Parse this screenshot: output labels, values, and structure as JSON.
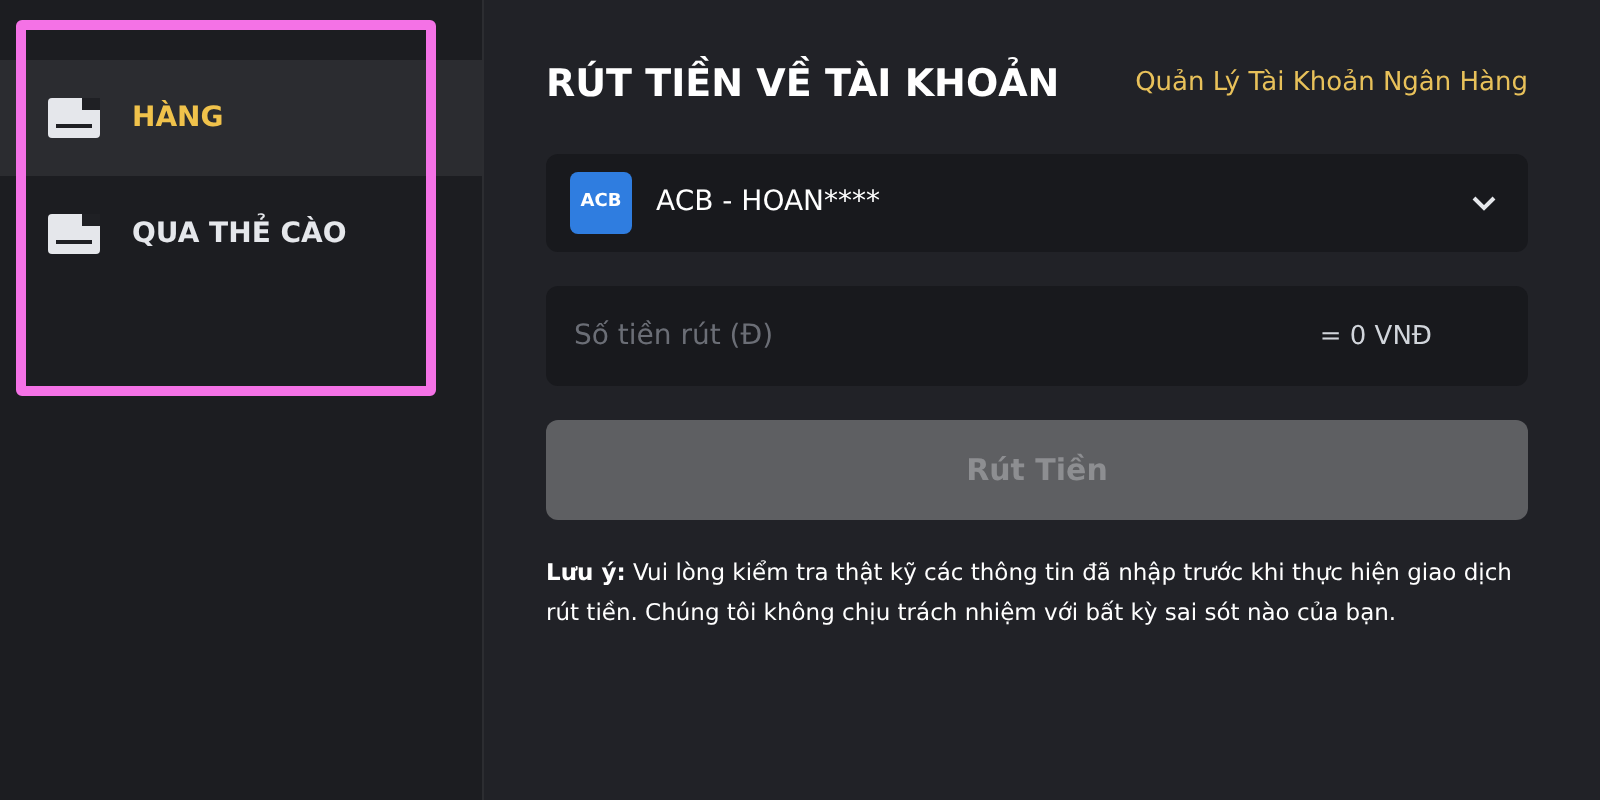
{
  "sidebar": {
    "items": [
      {
        "label": "HÀNG",
        "selected": true
      },
      {
        "label": "QUA THẺ CÀO",
        "selected": false
      }
    ]
  },
  "main": {
    "title": "RÚT TIỀN VỀ TÀI KHOẢN",
    "link": "Quản Lý Tài Khoản Ngân Hàng",
    "bank_select": {
      "logo": "ACB",
      "value": "ACB - HOAN****"
    },
    "amount_field": {
      "placeholder": "Số tiền rút (Đ)",
      "conversion": "= 0 VNĐ"
    },
    "submit": {
      "label": "Rút Tiền",
      "disabled": true
    },
    "note": "**Lưu ý:** Vui lòng kiểm tra thật kỹ các thông tin đã nhập trước khi thực hiện giao dịch rút tiền. Chúng tôi không chịu trách nhiệm với bất kỳ sai sót nào của bạn."
  }
}
